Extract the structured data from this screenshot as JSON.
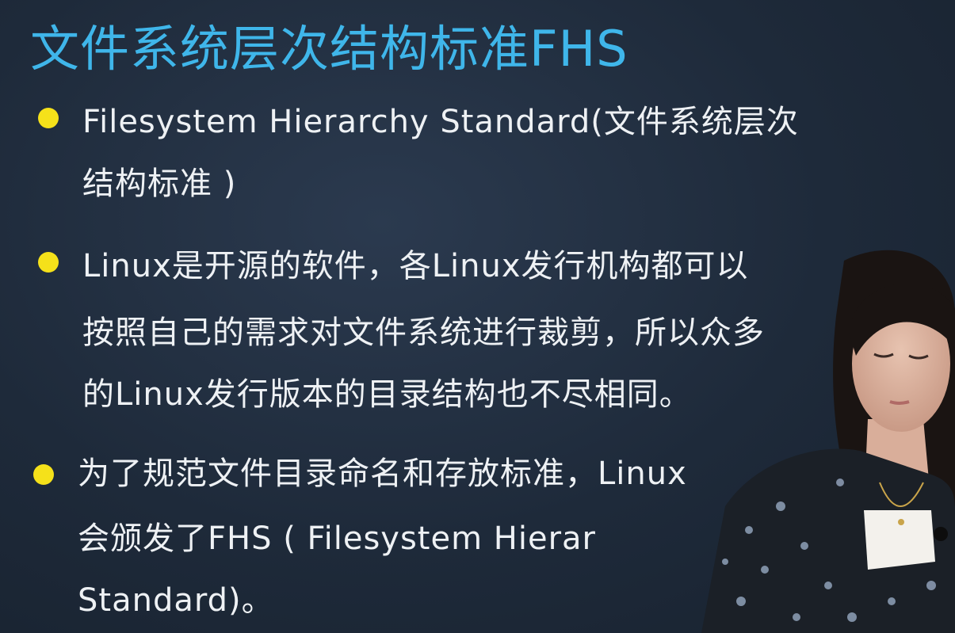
{
  "slide": {
    "title": "文件系统层次结构标准FHS",
    "bullets": [
      {
        "lines": [
          "Filesystem Hierarchy Standard(文件系统层次",
          "结构标准 )"
        ]
      },
      {
        "lines": [
          "Linux是开源的软件，各Linux发行机构都可以",
          "按照自己的需求对文件系统进行裁剪，所以众多",
          "的Linux发行版本的目录结构也不尽相同。"
        ]
      },
      {
        "lines": [
          "为了规范文件目录命名和存放标准，Linux",
          "会颁发了FHS ( Filesystem  Hierar",
          "Standard)。"
        ]
      }
    ]
  },
  "colors": {
    "title": "#3fb6ea",
    "bullet_dot": "#f5e11a",
    "background": "#1e2a3a"
  }
}
